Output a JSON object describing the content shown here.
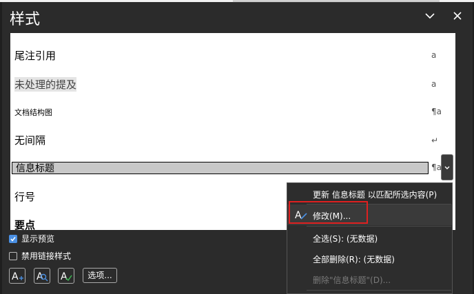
{
  "window": {
    "title": "样式"
  },
  "header_icons": [
    "chevron-down-icon",
    "close-icon"
  ],
  "styles": [
    {
      "label": "尾注引用",
      "symbol": "a"
    },
    {
      "label": "未处理的提及",
      "symbol": "a"
    },
    {
      "label": "文档结构图",
      "symbol": "¶a"
    },
    {
      "label": "无间隔",
      "symbol": "↵"
    },
    {
      "label": "信息标题",
      "symbol": "¶a"
    },
    {
      "label": "行号",
      "symbol": ""
    },
    {
      "label": "要点",
      "symbol": ""
    }
  ],
  "options": {
    "show_preview": "显示预览",
    "show_preview_checked": true,
    "disable_linked": "禁用链接样式",
    "disable_linked_checked": false,
    "options_button": "选项..."
  },
  "toolbar_icons": [
    "new-style-icon",
    "style-inspector-icon",
    "manage-styles-icon"
  ],
  "context_menu": {
    "items": [
      {
        "label": "更新 信息标题 以匹配所选内容(P)",
        "enabled": true
      },
      {
        "label": "修改(M)...",
        "enabled": true,
        "icon": "modify-style-icon"
      },
      {
        "label": "全选(S): (无数据)",
        "enabled": true
      },
      {
        "label": "全部删除(R): (无数据)",
        "enabled": true
      },
      {
        "label": "删除\"信息标题\"(D)...",
        "enabled": false
      }
    ]
  },
  "colors": {
    "highlight_box": "#e02020",
    "checkbox_accent": "#4a8fe2"
  }
}
